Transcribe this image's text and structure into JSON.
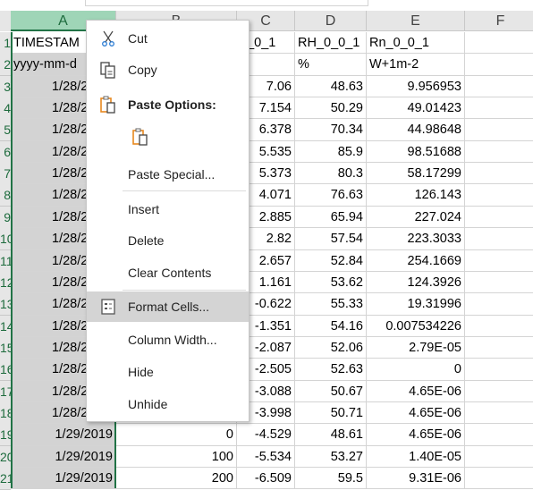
{
  "columns": [
    {
      "id": "A",
      "selected": true
    },
    {
      "id": "B"
    },
    {
      "id": "C"
    },
    {
      "id": "D"
    },
    {
      "id": "E"
    },
    {
      "id": "F"
    }
  ],
  "row_numbers": [
    "1",
    "2",
    "3",
    "4",
    "5",
    "6",
    "7",
    "8",
    "9",
    "10",
    "11",
    "12",
    "13",
    "14",
    "15",
    "16",
    "17",
    "18",
    "19",
    "20",
    "21"
  ],
  "rows": [
    [
      "TIMESTAM",
      "",
      "0_0_1",
      "RH_0_0_1",
      "Rn_0_0_1"
    ],
    [
      "yyyy-mm-d",
      "",
      "",
      "%",
      "W+1m-2"
    ],
    [
      "1/28/2",
      "",
      "7.06",
      "48.63",
      "9.956953"
    ],
    [
      "1/28/2",
      "",
      "7.154",
      "50.29",
      "49.01423"
    ],
    [
      "1/28/2",
      "",
      "6.378",
      "70.34",
      "44.98648"
    ],
    [
      "1/28/2",
      "",
      "5.535",
      "85.9",
      "98.51688"
    ],
    [
      "1/28/2",
      "",
      "5.373",
      "80.3",
      "58.17299"
    ],
    [
      "1/28/2",
      "",
      "4.071",
      "76.63",
      "126.143"
    ],
    [
      "1/28/2",
      "",
      "2.885",
      "65.94",
      "227.024"
    ],
    [
      "1/28/2",
      "",
      "2.82",
      "57.54",
      "223.3033"
    ],
    [
      "1/28/2",
      "",
      "2.657",
      "52.84",
      "254.1669"
    ],
    [
      "1/28/2",
      "",
      "1.161",
      "53.62",
      "124.3926"
    ],
    [
      "1/28/2",
      "",
      "-0.622",
      "55.33",
      "19.31996"
    ],
    [
      "1/28/2",
      "",
      "-1.351",
      "54.16",
      "0.007534226"
    ],
    [
      "1/28/2",
      "",
      "-2.087",
      "52.06",
      "2.79E-05"
    ],
    [
      "1/28/2",
      "",
      "-2.505",
      "52.63",
      "0"
    ],
    [
      "1/28/2",
      "",
      "-3.088",
      "50.67",
      "4.65E-06"
    ],
    [
      "1/28/2",
      "",
      "-3.998",
      "50.71",
      "4.65E-06"
    ],
    [
      "1/29/2019",
      "0",
      "-4.529",
      "48.61",
      "4.65E-06"
    ],
    [
      "1/29/2019",
      "100",
      "-5.534",
      "53.27",
      "1.40E-05"
    ],
    [
      "1/29/2019",
      "200",
      "-6.509",
      "59.5",
      "9.31E-06"
    ]
  ],
  "context_menu": {
    "cut": "Cut",
    "copy": "Copy",
    "paste_options": "Paste Options:",
    "paste_special": "Paste Special...",
    "insert": "Insert",
    "delete": "Delete",
    "clear_contents": "Clear Contents",
    "format_cells": "Format Cells...",
    "column_width": "Column Width...",
    "hide": "Hide",
    "unhide": "Unhide"
  },
  "colors": {
    "accent": "#217346",
    "selected_header": "#9fd5b7",
    "icon_orange": "#e8891f",
    "icon_blue": "#2b7cd3"
  }
}
